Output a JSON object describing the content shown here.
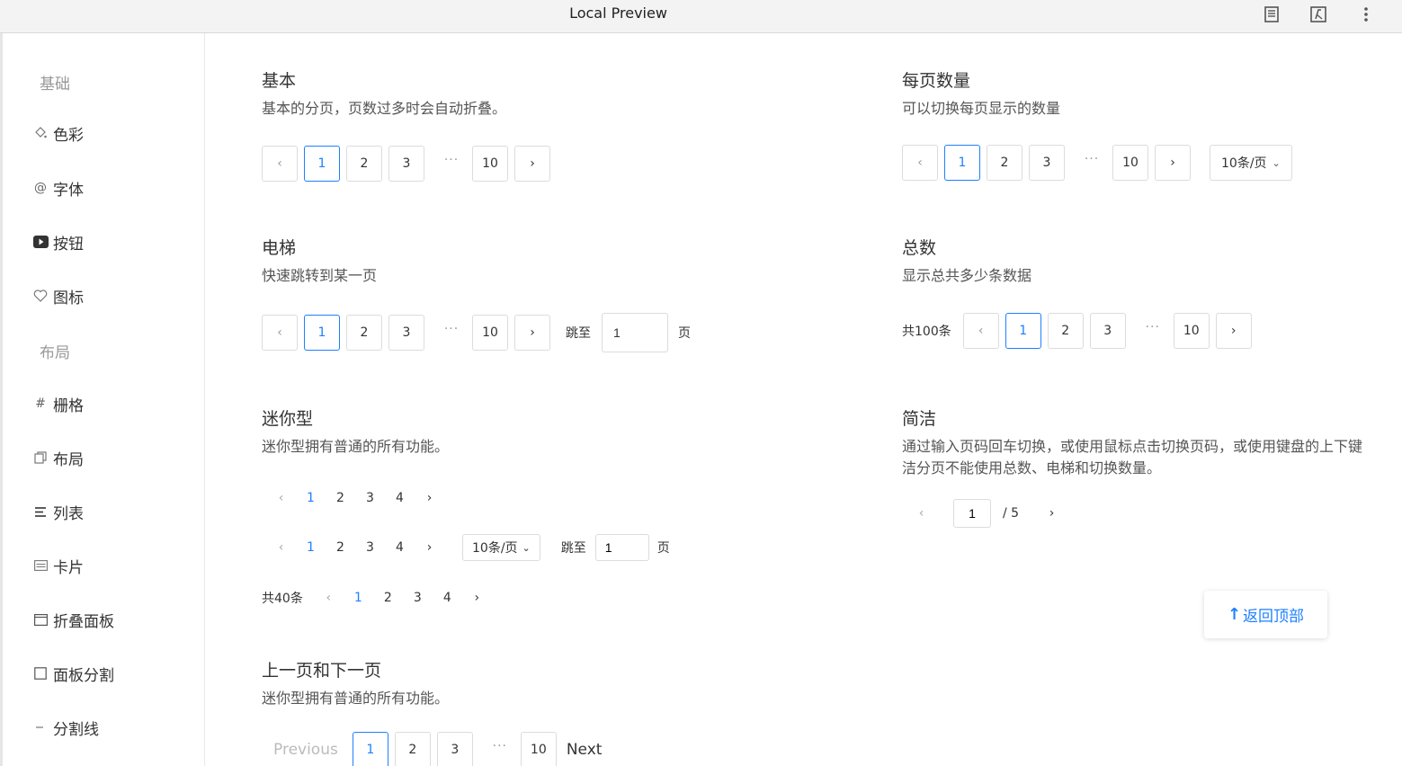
{
  "window": {
    "title": "Local Preview"
  },
  "sidebar": {
    "groups": {
      "basic": "基础",
      "layout": "布局"
    },
    "items": [
      {
        "label": "色彩",
        "icon": "paint-bucket-icon"
      },
      {
        "label": "字体",
        "icon": "at-sign-icon"
      },
      {
        "label": "按钮",
        "icon": "play-button-icon"
      },
      {
        "label": "图标",
        "icon": "heart-icon"
      },
      {
        "label": "栅格",
        "icon": "hash-icon"
      },
      {
        "label": "布局",
        "icon": "copy-icon"
      },
      {
        "label": "列表",
        "icon": "list-icon"
      },
      {
        "label": "卡片",
        "icon": "card-icon"
      },
      {
        "label": "折叠面板",
        "icon": "panel-icon"
      },
      {
        "label": "面板分割",
        "icon": "square-icon"
      },
      {
        "label": "分割线",
        "icon": "minus-icon"
      }
    ]
  },
  "pager": {
    "p1": "1",
    "p2": "2",
    "p3": "3",
    "p4": "4",
    "p5": "5",
    "p10": "10",
    "ellipsis": "···"
  },
  "sections": {
    "basic": {
      "title": "基本",
      "desc": "基本的分页，页数过多时会自动折叠。"
    },
    "page_size": {
      "title": "每页数量",
      "desc": "可以切换每页显示的数量",
      "size_label": "10条/页"
    },
    "elevator": {
      "title": "电梯",
      "desc": "快速跳转到某一页",
      "jump_label": "跳至",
      "page_label": "页",
      "jump_value": "1"
    },
    "total": {
      "title": "总数",
      "desc": "显示总共多少条数据",
      "total_label": "共100条"
    },
    "mini": {
      "title": "迷你型",
      "desc": "迷你型拥有普通的所有功能。",
      "size_label": "10条/页",
      "jump_label": "跳至",
      "page_label": "页",
      "jump_value": "1",
      "total_label": "共40条"
    },
    "simple": {
      "title": "简洁",
      "desc_line1": "通过输入页码回车切换，或使用鼠标点击切换页码，或使用键盘的上下键",
      "desc_line2": "洁分页不能使用总数、电梯和切换数量。",
      "value": "1",
      "total": "/ 5"
    },
    "prevnext": {
      "title": "上一页和下一页",
      "desc": "迷你型拥有普通的所有功能。",
      "prev": "Previous",
      "next": "Next"
    }
  },
  "backtop": {
    "label": "返回顶部"
  },
  "colors": {
    "accent": "#1e80ff"
  }
}
